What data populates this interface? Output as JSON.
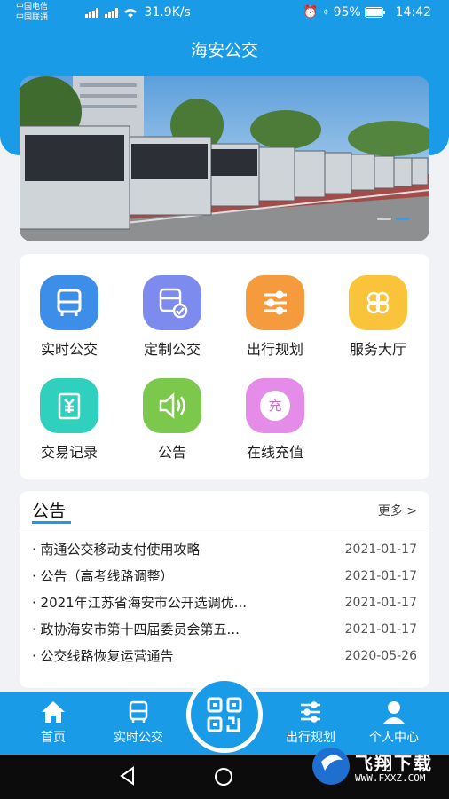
{
  "status": {
    "carrier1": "中国电信",
    "carrier2": "中国联通",
    "net_speed": "31.9K/s",
    "battery": "95%",
    "time": "14:42"
  },
  "app_title": "海安公交",
  "banner": {
    "pages": 2,
    "active_page": 1
  },
  "grid": [
    {
      "label": "实时公交",
      "icon": "bus-icon",
      "color": "#3d8ee8"
    },
    {
      "label": "定制公交",
      "icon": "custom-bus-icon",
      "color": "#7d8bee"
    },
    {
      "label": "出行规划",
      "icon": "route-plan-icon",
      "color": "#f59a3d"
    },
    {
      "label": "服务大厅",
      "icon": "service-hall-icon",
      "color": "#f9c43a"
    },
    {
      "label": "交易记录",
      "icon": "receipt-icon",
      "color": "#2fd0bd"
    },
    {
      "label": "公告",
      "icon": "speaker-icon",
      "color": "#7cc84c"
    },
    {
      "label": "在线充值",
      "icon": "recharge-icon",
      "color": "#e58ce8",
      "badge": "充"
    }
  ],
  "notice": {
    "title": "公告",
    "more": "更多 >",
    "items": [
      {
        "title": "南通公交移动支付使用攻略",
        "date": "2021-01-17"
      },
      {
        "title": "公告（高考线路调整）",
        "date": "2021-01-17"
      },
      {
        "title": "2021年江苏省海安市公开选调优...",
        "date": "2021-01-17"
      },
      {
        "title": "政协海安市第十四届委员会第五...",
        "date": "2021-01-17"
      },
      {
        "title": "公交线路恢复运营通告",
        "date": "2020-05-26"
      }
    ]
  },
  "tabs": [
    {
      "label": "首页",
      "icon": "home-icon"
    },
    {
      "label": "实时公交",
      "icon": "bus-icon"
    },
    {
      "label": "出行规划",
      "icon": "route-plan-icon"
    },
    {
      "label": "个人中心",
      "icon": "user-icon"
    }
  ],
  "watermark": {
    "text": "飞翔下载",
    "url": "WWW.FXXZ.COM"
  },
  "colors": {
    "primary": "#1a9be8",
    "background": "#f0f2f5"
  }
}
